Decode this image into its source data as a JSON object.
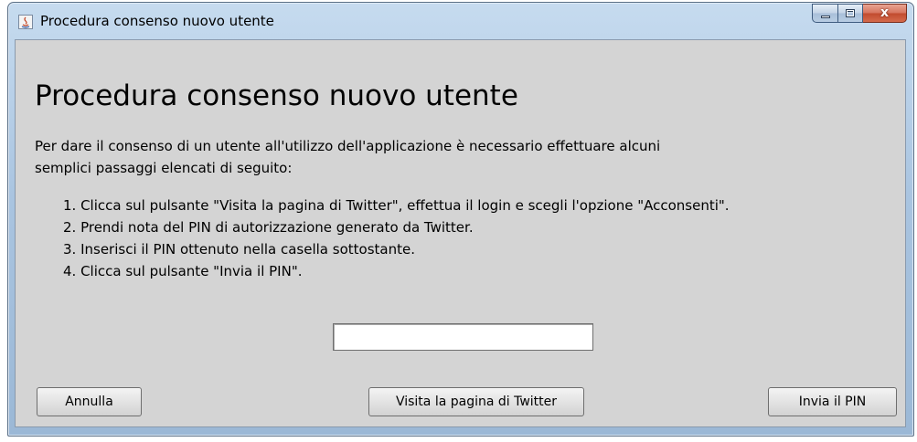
{
  "window": {
    "title": "Procedura consenso nuovo utente",
    "icon": "java-icon",
    "controls": {
      "minimize_icon": "minimize-icon",
      "maximize_icon": "maximize-icon",
      "close_label": "x"
    }
  },
  "content": {
    "heading": "Procedura consenso nuovo utente",
    "intro_lines": [
      "Per dare il consenso di un utente all'utilizzo dell'applicazione è necessario effettuare alcuni",
      "semplici passaggi elencati di seguito:"
    ],
    "steps": [
      "1. Clicca sul pulsante \"Visita la pagina di Twitter\", effettua il login e scegli l'opzione \"Acconsenti\".",
      "2. Prendi nota del PIN di autorizzazione generato da Twitter.",
      "3. Inserisci il PIN ottenuto nella casella sottostante.",
      "4. Clicca sul pulsante \"Invia il PIN\"."
    ],
    "pin_input": {
      "value": "",
      "placeholder": ""
    }
  },
  "buttons": {
    "cancel_label": "Annulla",
    "visit_label": "Visita la pagina di Twitter",
    "send_label": "Invia il PIN"
  },
  "colors": {
    "client_background": "#d4d4d4",
    "titlebar_accent": "#a9c4e0",
    "close_button": "#c14a2e"
  }
}
